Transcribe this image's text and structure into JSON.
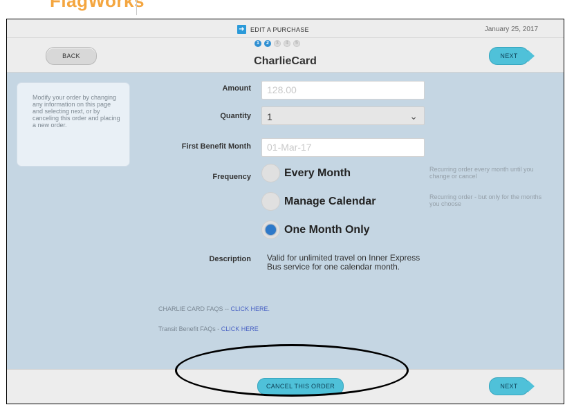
{
  "app": {
    "logo": "FlagWorks"
  },
  "header": {
    "step_title": "EDIT A PURCHASE",
    "date": "January 25, 2017",
    "back_label": "BACK",
    "next_label": "NEXT",
    "steps": [
      "1",
      "2",
      "3",
      "4",
      "5"
    ],
    "current_step": 2,
    "card_title": "CharlieCard"
  },
  "help": {
    "text": "Modify your order by changing any information on this page and selecting next, or by canceling this order and placing a new order."
  },
  "form": {
    "amount_label": "Amount",
    "amount_value": "128.00",
    "quantity_label": "Quantity",
    "quantity_value": "1",
    "first_benefit_label": "First Benefit Month",
    "first_benefit_value": "01-Mar-17",
    "frequency_label": "Frequency",
    "frequency_options": [
      {
        "label": "Every Month",
        "selected": false,
        "note": "Recurring order every month until you change or cancel"
      },
      {
        "label": "Manage Calendar",
        "selected": false,
        "note": "Recurring order - but only for the months you choose"
      },
      {
        "label": "One Month Only",
        "selected": true,
        "note": ""
      }
    ],
    "description_label": "Description",
    "description_value": "Valid for unlimited travel on Inner Express Bus service for one calendar month."
  },
  "links": {
    "charlie_faq_prefix": "CHARLIE CARD FAQS -- ",
    "charlie_faq_link": "CLICK HERE.",
    "transit_faq_prefix": "Transit Benefit FAQs - ",
    "transit_faq_link": "CLICK HERE"
  },
  "footer": {
    "cancel_label": "CANCEL THIS ORDER",
    "next_label": "NEXT"
  },
  "colors": {
    "accent": "#4fc1d9",
    "panel_bg": "#c5d6e3",
    "step_active": "#2e8fd2",
    "logo": "#f4a640"
  }
}
